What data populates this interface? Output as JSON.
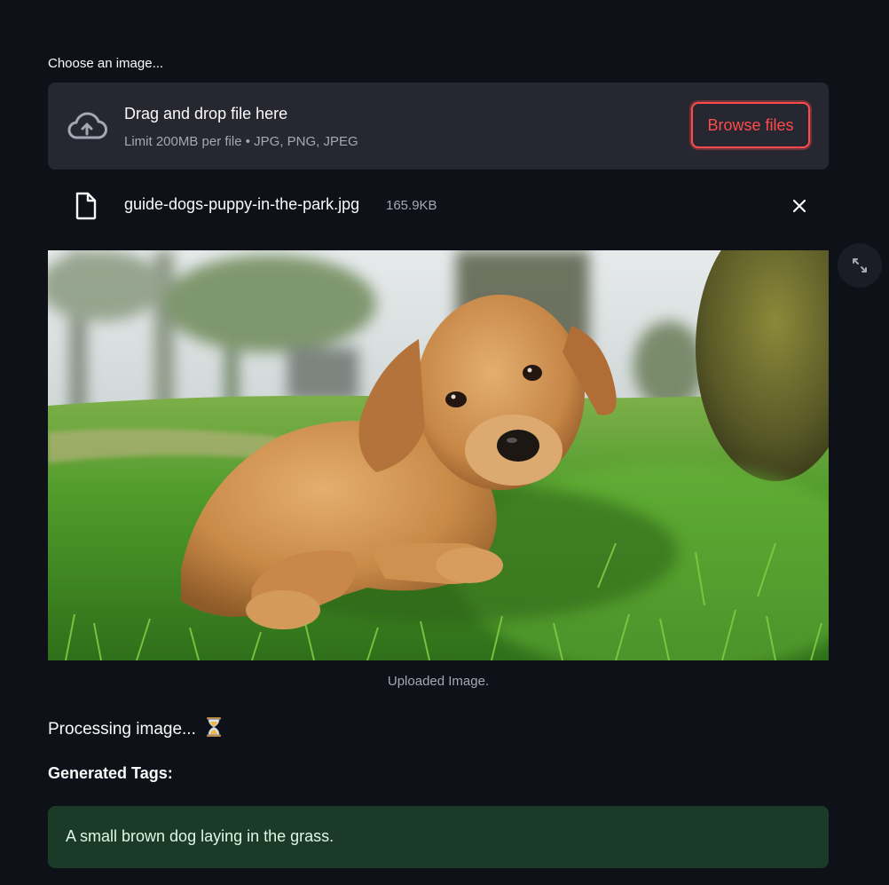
{
  "uploader": {
    "label": "Choose an image...",
    "drop_title": "Drag and drop file here",
    "drop_limit": "Limit 200MB per file • JPG, PNG, JPEG",
    "browse_label": "Browse files"
  },
  "file": {
    "name": "guide-dogs-puppy-in-the-park.jpg",
    "size": "165.9KB"
  },
  "image": {
    "caption": "Uploaded Image."
  },
  "status": {
    "processing": "Processing image..."
  },
  "tags": {
    "heading": "Generated Tags:",
    "result": "A small brown dog laying in the grass."
  },
  "icons": {
    "upload": "cloud-upload-icon",
    "file": "file-icon",
    "close": "close-icon",
    "fullscreen": "fullscreen-icon",
    "hourglass": "hourglass-icon"
  },
  "colors": {
    "background": "#0e1117",
    "accent": "#ff4b4b",
    "panel": "#262730",
    "success_bg": "#1c3a28"
  }
}
